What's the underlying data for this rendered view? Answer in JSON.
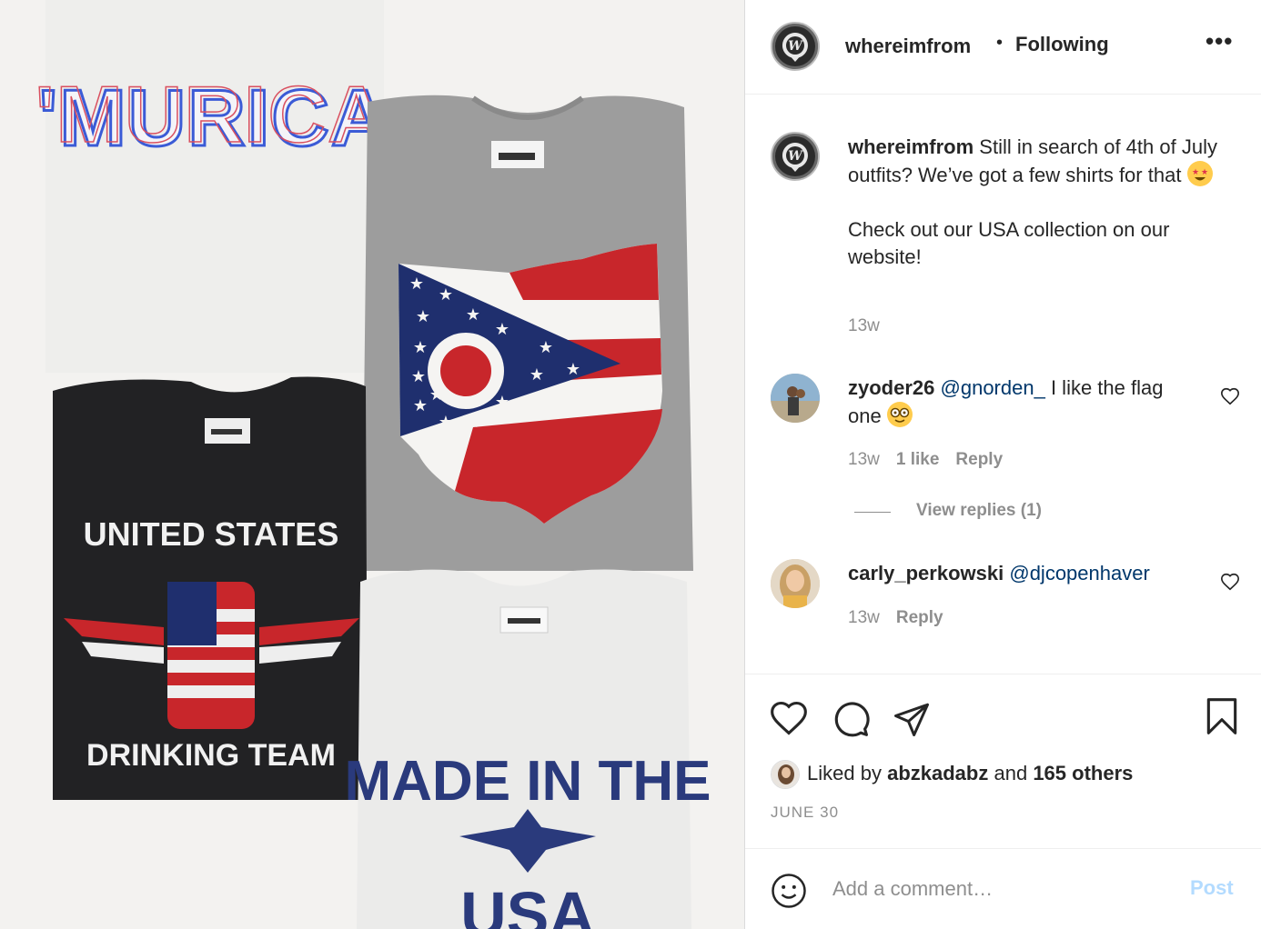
{
  "post": {
    "image_alt": "Flat lay of patriotic t-shirts",
    "shirt_texts": {
      "murica": "'MURICA",
      "drinking_top": "UNITED STATES",
      "drinking_bottom": "DRINKING TEAM",
      "made_in": "MADE IN THE",
      "usa": "USA"
    }
  },
  "header": {
    "username": "whereimfrom",
    "separator": "•",
    "follow_status": "Following",
    "more": "•••"
  },
  "caption": {
    "username": "whereimfrom",
    "text_line1": "Still in search of 4th of July outfits? We’ve got a few shirts for that",
    "text_line2": "Check out our USA collection on our website!",
    "time": "13w",
    "emoji": "star-struck-emoji"
  },
  "comments": [
    {
      "username": "zyoder26",
      "mention": "@gnorden_",
      "text": "I like the flag one",
      "emoji": "nerd-face-emoji",
      "time": "13w",
      "likes": "1 like",
      "reply": "Reply",
      "view_replies": "View replies (1)"
    },
    {
      "username": "carly_perkowski",
      "mention": "@djcopenhaver",
      "time": "13w",
      "reply": "Reply"
    }
  ],
  "actions": {
    "liked_by_prefix": "Liked by",
    "liked_by_user": "abzkadabz",
    "liked_by_and": "and",
    "liked_by_others": "165 others",
    "date": "JUNE 30"
  },
  "add_comment": {
    "placeholder": "Add a comment…",
    "post_label": "Post"
  },
  "colors": {
    "text": "#262626",
    "secondary": "#8e8e8e",
    "mention": "#00376b",
    "post_disabled": "#b3dbff",
    "flag_red": "#c8262b",
    "flag_blue": "#1f2f6e"
  }
}
